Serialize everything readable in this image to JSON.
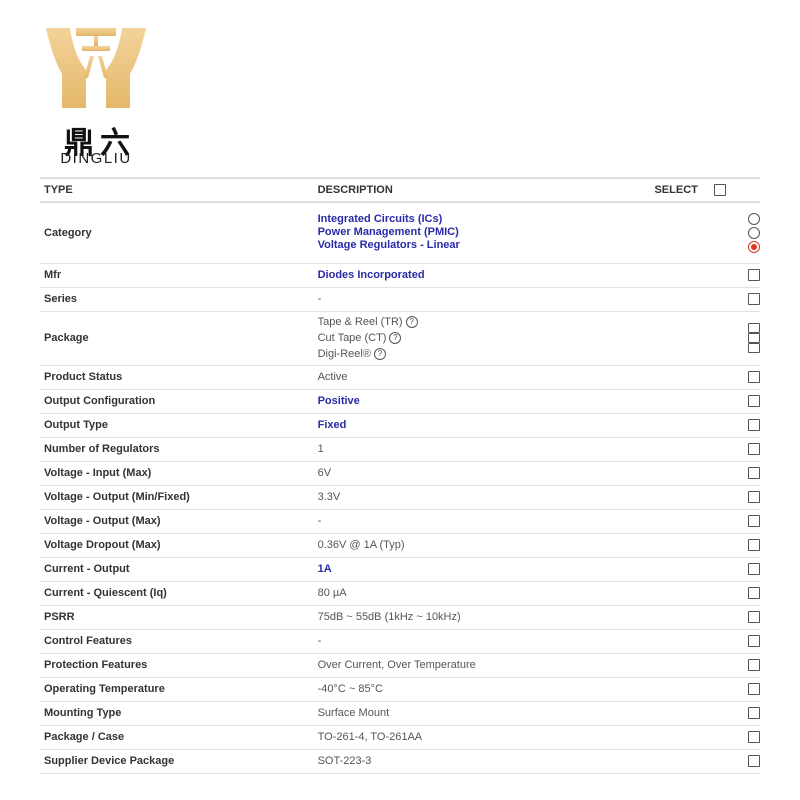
{
  "brand": {
    "name_cn": "鼎六",
    "name_en": "DINGLIU",
    "logo_color": "#e8c27a"
  },
  "table": {
    "headers": {
      "type": "TYPE",
      "description": "DESCRIPTION",
      "select": "SELECT"
    },
    "category": {
      "label": "Category",
      "values": [
        "Integrated Circuits (ICs)",
        "Power Management (PMIC)",
        "Voltage Regulators - Linear"
      ],
      "selected_index": 2
    },
    "mfr": {
      "label": "Mfr",
      "value": "Diodes Incorporated"
    },
    "series": {
      "label": "Series",
      "value": "-"
    },
    "package": {
      "label": "Package",
      "options": [
        "Tape & Reel (TR)",
        "Cut Tape (CT)",
        "Digi-Reel®"
      ],
      "help_icon": "question-circle-icon"
    },
    "rows": [
      {
        "label": "Product Status",
        "value": "Active",
        "link": false
      },
      {
        "label": "Output Configuration",
        "value": "Positive",
        "link": true
      },
      {
        "label": "Output Type",
        "value": "Fixed",
        "link": true
      },
      {
        "label": "Number of Regulators",
        "value": "1",
        "link": false
      },
      {
        "label": "Voltage - Input (Max)",
        "value": "6V",
        "link": false
      },
      {
        "label": "Voltage - Output (Min/Fixed)",
        "value": "3.3V",
        "link": false
      },
      {
        "label": "Voltage - Output (Max)",
        "value": "-",
        "link": false
      },
      {
        "label": "Voltage Dropout (Max)",
        "value": "0.36V @ 1A (Typ)",
        "link": false
      },
      {
        "label": "Current - Output",
        "value": "1A",
        "link": true
      },
      {
        "label": "Current - Quiescent (Iq)",
        "value": "80 µA",
        "link": false
      },
      {
        "label": "PSRR",
        "value": "75dB ~ 55dB (1kHz ~ 10kHz)",
        "link": false
      },
      {
        "label": "Control Features",
        "value": "-",
        "link": false
      },
      {
        "label": "Protection Features",
        "value": "Over Current, Over Temperature",
        "link": false
      },
      {
        "label": "Operating Temperature",
        "value": "-40°C ~ 85°C",
        "link": false
      },
      {
        "label": "Mounting Type",
        "value": "Surface Mount",
        "link": false
      },
      {
        "label": "Package / Case",
        "value": "TO-261-4, TO-261AA",
        "link": false
      },
      {
        "label": "Supplier Device Package",
        "value": "SOT-223-3",
        "link": false
      }
    ]
  }
}
